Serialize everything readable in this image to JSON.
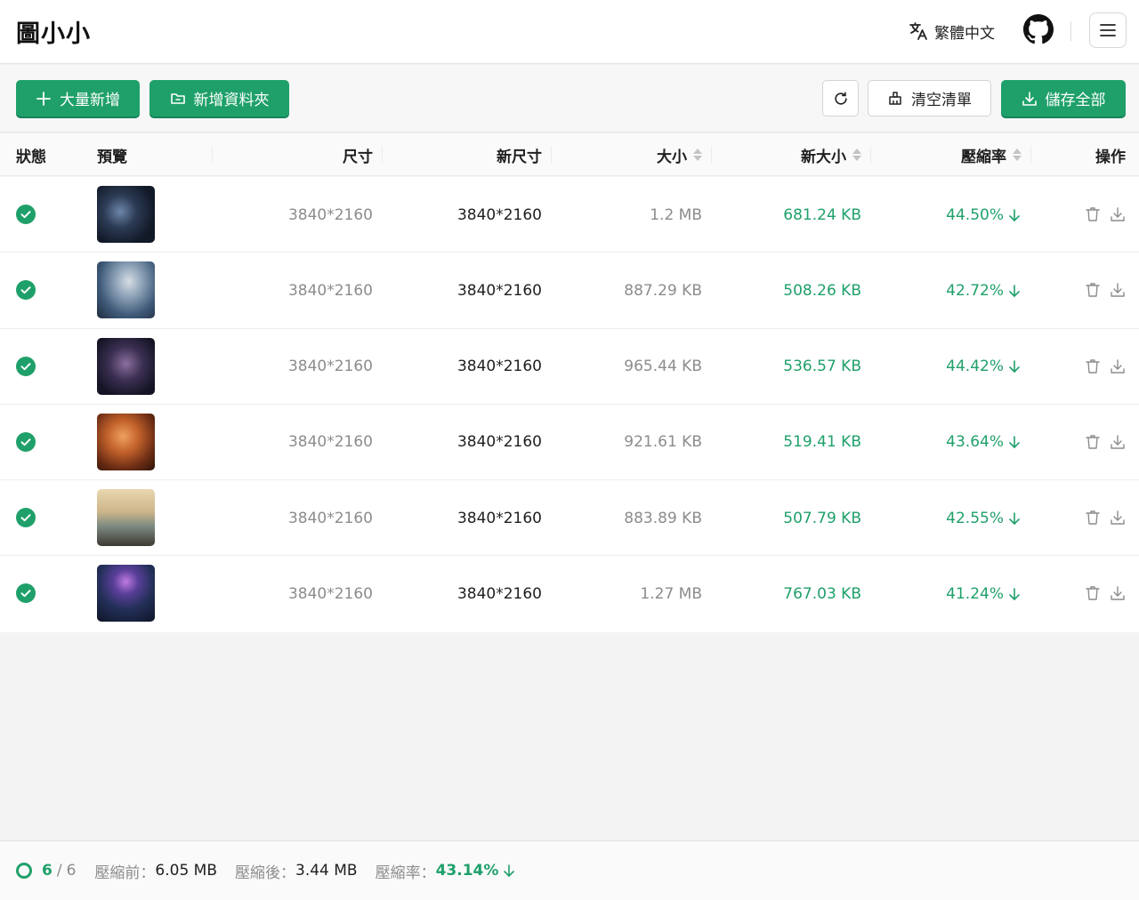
{
  "app": {
    "title": "圖小小"
  },
  "header": {
    "language": "繁體中文"
  },
  "toolbar": {
    "bulk_add": "大量新增",
    "add_folder": "新增資料夾",
    "clear_list": "清空清單",
    "save_all": "儲存全部"
  },
  "table": {
    "headers": {
      "status": "狀態",
      "preview": "預覽",
      "size": "尺寸",
      "new_size": "新尺寸",
      "file_size": "大小",
      "new_file_size": "新大小",
      "ratio": "壓縮率",
      "actions": "操作"
    },
    "rows": [
      {
        "dimension": "3840*2160",
        "new_dimension": "3840*2160",
        "size": "1.2 MB",
        "new_size": "681.24 KB",
        "ratio": "44.50%"
      },
      {
        "dimension": "3840*2160",
        "new_dimension": "3840*2160",
        "size": "887.29 KB",
        "new_size": "508.26 KB",
        "ratio": "42.72%"
      },
      {
        "dimension": "3840*2160",
        "new_dimension": "3840*2160",
        "size": "965.44 KB",
        "new_size": "536.57 KB",
        "ratio": "44.42%"
      },
      {
        "dimension": "3840*2160",
        "new_dimension": "3840*2160",
        "size": "921.61 KB",
        "new_size": "519.41 KB",
        "ratio": "43.64%"
      },
      {
        "dimension": "3840*2160",
        "new_dimension": "3840*2160",
        "size": "883.89 KB",
        "new_size": "507.79 KB",
        "ratio": "42.55%"
      },
      {
        "dimension": "3840*2160",
        "new_dimension": "3840*2160",
        "size": "1.27 MB",
        "new_size": "767.03 KB",
        "ratio": "41.24%"
      }
    ]
  },
  "footer": {
    "done": "6",
    "total": "6",
    "before_label": "壓縮前：",
    "before_value": "6.05 MB",
    "after_label": "壓縮後：",
    "after_value": "3.44 MB",
    "ratio_label": "壓縮率：",
    "ratio_value": "43.14%"
  },
  "colors": {
    "accent": "#1fa06a",
    "muted": "#8c8c8c",
    "text": "#1f1f1f"
  },
  "icons": {
    "status": "check-circle-icon",
    "delete": "trash-icon",
    "download": "download-icon",
    "trend": "arrow-down-icon",
    "translate": "translate-icon",
    "github": "github-icon",
    "menu": "hamburger-icon",
    "refresh": "refresh-icon",
    "clear": "broom-icon",
    "folder": "folder-icon",
    "plus": "plus-icon"
  }
}
